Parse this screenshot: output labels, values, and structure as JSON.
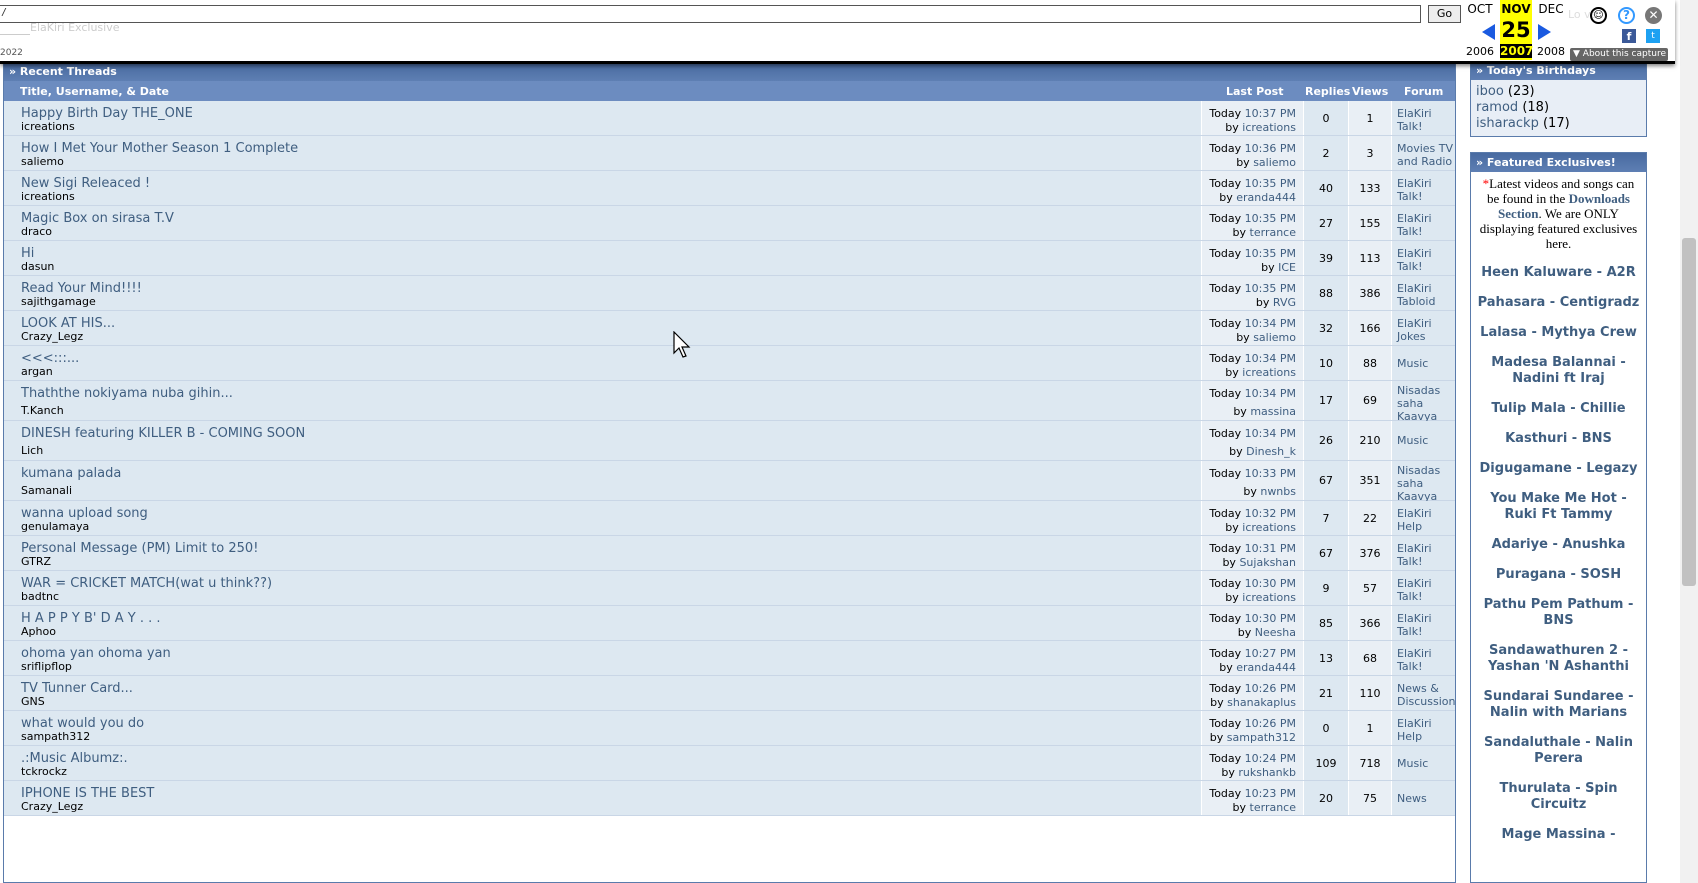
{
  "wayback": {
    "url": "/",
    "go_label": "Go",
    "sub1": "ElaKiri Exclusive",
    "sub2": "2022",
    "prev_month": "OCT",
    "prev_year": "2006",
    "cur_month": "NOV",
    "cur_day": "25",
    "cur_year": "2007",
    "next_month": "DEC",
    "next_year": "2008",
    "about_label": "▼ About this capture",
    "ghost_text": "Lo ve",
    "fb": "f",
    "tw": "t"
  },
  "threads": {
    "header": "» Recent Threads",
    "columns": {
      "title": "Title, Username, & Date",
      "last_post": "Last Post",
      "replies": "Replies",
      "views": "Views",
      "forum": "Forum"
    },
    "rows": [
      {
        "title": "Happy Birth Day THE_ONE",
        "user": "icreations",
        "time": "10:37 PM",
        "by": "icreations",
        "replies": "0",
        "views": "1",
        "forum": [
          "ElaKiri",
          "Talk!"
        ]
      },
      {
        "title": "How I Met Your Mother Season 1 Complete",
        "user": "saliemo",
        "time": "10:36 PM",
        "by": "saliemo",
        "replies": "2",
        "views": "3",
        "forum": [
          "Movies TV",
          "and Radio"
        ]
      },
      {
        "title": "New Sigi Releaced !",
        "user": "icreations",
        "time": "10:35 PM",
        "by": "eranda444",
        "replies": "40",
        "views": "133",
        "forum": [
          "ElaKiri",
          "Talk!"
        ]
      },
      {
        "title": "Magic Box on sirasa T.V",
        "user": "draco",
        "time": "10:35 PM",
        "by": "terrance",
        "replies": "27",
        "views": "155",
        "forum": [
          "ElaKiri",
          "Talk!"
        ]
      },
      {
        "title": "Hi",
        "user": "dasun",
        "time": "10:35 PM",
        "by": "ICE",
        "replies": "39",
        "views": "113",
        "forum": [
          "ElaKiri",
          "Talk!"
        ]
      },
      {
        "title": "Read Your Mind!!!!",
        "user": "sajithgamage",
        "time": "10:35 PM",
        "by": "RVG",
        "replies": "88",
        "views": "386",
        "forum": [
          "ElaKiri",
          "Tabloid"
        ]
      },
      {
        "title": "LOOK AT HIS...",
        "user": "Crazy_Legz",
        "time": "10:34 PM",
        "by": "saliemo",
        "replies": "32",
        "views": "166",
        "forum": [
          "ElaKiri",
          "Jokes"
        ]
      },
      {
        "title": "<<<:::...",
        "user": "argan",
        "time": "10:34 PM",
        "by": "icreations",
        "replies": "10",
        "views": "88",
        "forum": [
          "Music"
        ]
      },
      {
        "title": "Thaththe nokiyama nuba gihin...",
        "user": "T.Kanch",
        "time": "10:34 PM",
        "by": "massina",
        "replies": "17",
        "views": "69",
        "forum": [
          "Nisadas",
          "saha",
          "Kaavya"
        ]
      },
      {
        "title": "DINESH featuring KILLER B - COMING SOON",
        "user": "Lich",
        "time": "10:34 PM",
        "by": "Dinesh_k",
        "replies": "26",
        "views": "210",
        "forum": [
          "Music"
        ]
      },
      {
        "title": "kumana palada",
        "user": "Samanali",
        "time": "10:33 PM",
        "by": "nwnbs",
        "replies": "67",
        "views": "351",
        "forum": [
          "Nisadas",
          "saha",
          "Kaavya"
        ]
      },
      {
        "title": "wanna upload song",
        "user": "genulamaya",
        "time": "10:32 PM",
        "by": "icreations",
        "replies": "7",
        "views": "22",
        "forum": [
          "ElaKiri",
          "Help"
        ]
      },
      {
        "title": "Personal Message (PM) Limit to 250!",
        "user": "GTRZ",
        "time": "10:31 PM",
        "by": "Sujakshan",
        "replies": "67",
        "views": "376",
        "forum": [
          "ElaKiri",
          "Talk!"
        ]
      },
      {
        "title": "WAR = CRICKET MATCH(wat u think??)",
        "user": "badtnc",
        "time": "10:30 PM",
        "by": "icreations",
        "replies": "9",
        "views": "57",
        "forum": [
          "ElaKiri",
          "Talk!"
        ]
      },
      {
        "title": "H A P P Y B' D A Y . . .",
        "user": "Aphoo",
        "time": "10:30 PM",
        "by": "Neesha",
        "replies": "85",
        "views": "366",
        "forum": [
          "ElaKiri",
          "Talk!"
        ]
      },
      {
        "title": "ohoma yan ohoma yan",
        "user": "sriflipflop",
        "time": "10:27 PM",
        "by": "eranda444",
        "replies": "13",
        "views": "68",
        "forum": [
          "ElaKiri",
          "Talk!"
        ]
      },
      {
        "title": "TV Tunner Card...",
        "user": "GNS",
        "time": "10:26 PM",
        "by": "shanakaplus",
        "replies": "21",
        "views": "110",
        "forum": [
          "News &",
          "Discussion"
        ]
      },
      {
        "title": "what would you do",
        "user": "sampath312",
        "time": "10:26 PM",
        "by": "sampath312",
        "replies": "0",
        "views": "1",
        "forum": [
          "ElaKiri",
          "Help"
        ]
      },
      {
        "title": ".:Music Albumz:.",
        "user": "tckrockz",
        "time": "10:24 PM",
        "by": "rukshankb",
        "replies": "109",
        "views": "718",
        "forum": [
          "Music"
        ]
      },
      {
        "title": "IPHONE IS THE BEST",
        "user": "Crazy_Legz",
        "time": "10:23 PM",
        "by": "terrance",
        "replies": "20",
        "views": "75",
        "forum": [
          "News"
        ]
      }
    ],
    "today_label": "Today",
    "by_label": "by"
  },
  "birthdays": {
    "header": "» Today's Birthdays",
    "items": [
      {
        "name": "iboo",
        "age": "(23)"
      },
      {
        "name": "ramod",
        "age": "(18)"
      },
      {
        "name": "isharackp",
        "age": "(17)"
      }
    ]
  },
  "featured": {
    "header": "» Featured Exclusives!",
    "note_star": "*",
    "note_pre": "Latest videos and songs can be found in the ",
    "note_link": "Downloads Section",
    "note_post": ". We are ONLY displaying featured exclusives here.",
    "items": [
      "Heen Kaluware - A2R",
      "Pahasara - Centigradz",
      "Lalasa - Mythya Crew",
      "Madesa Balannai - Nadini ft Iraj",
      "Tulip Mala - Chillie",
      "Kasthuri - BNS",
      "Digugamane - Legazy",
      "You Make Me Hot - Ruki Ft Tammy",
      "Adariye - Anushka",
      "Puragana - SOSH",
      "Pathu Pem Pathum - BNS",
      "Sandawathuren 2 - Yashan 'N Ashanthi",
      "Sundarai Sundaree - Nalin with Marians",
      "Sandaluthale - Nalin Perera",
      "Thurulata - Spin Circuitz",
      "Mage Massina -"
    ]
  }
}
